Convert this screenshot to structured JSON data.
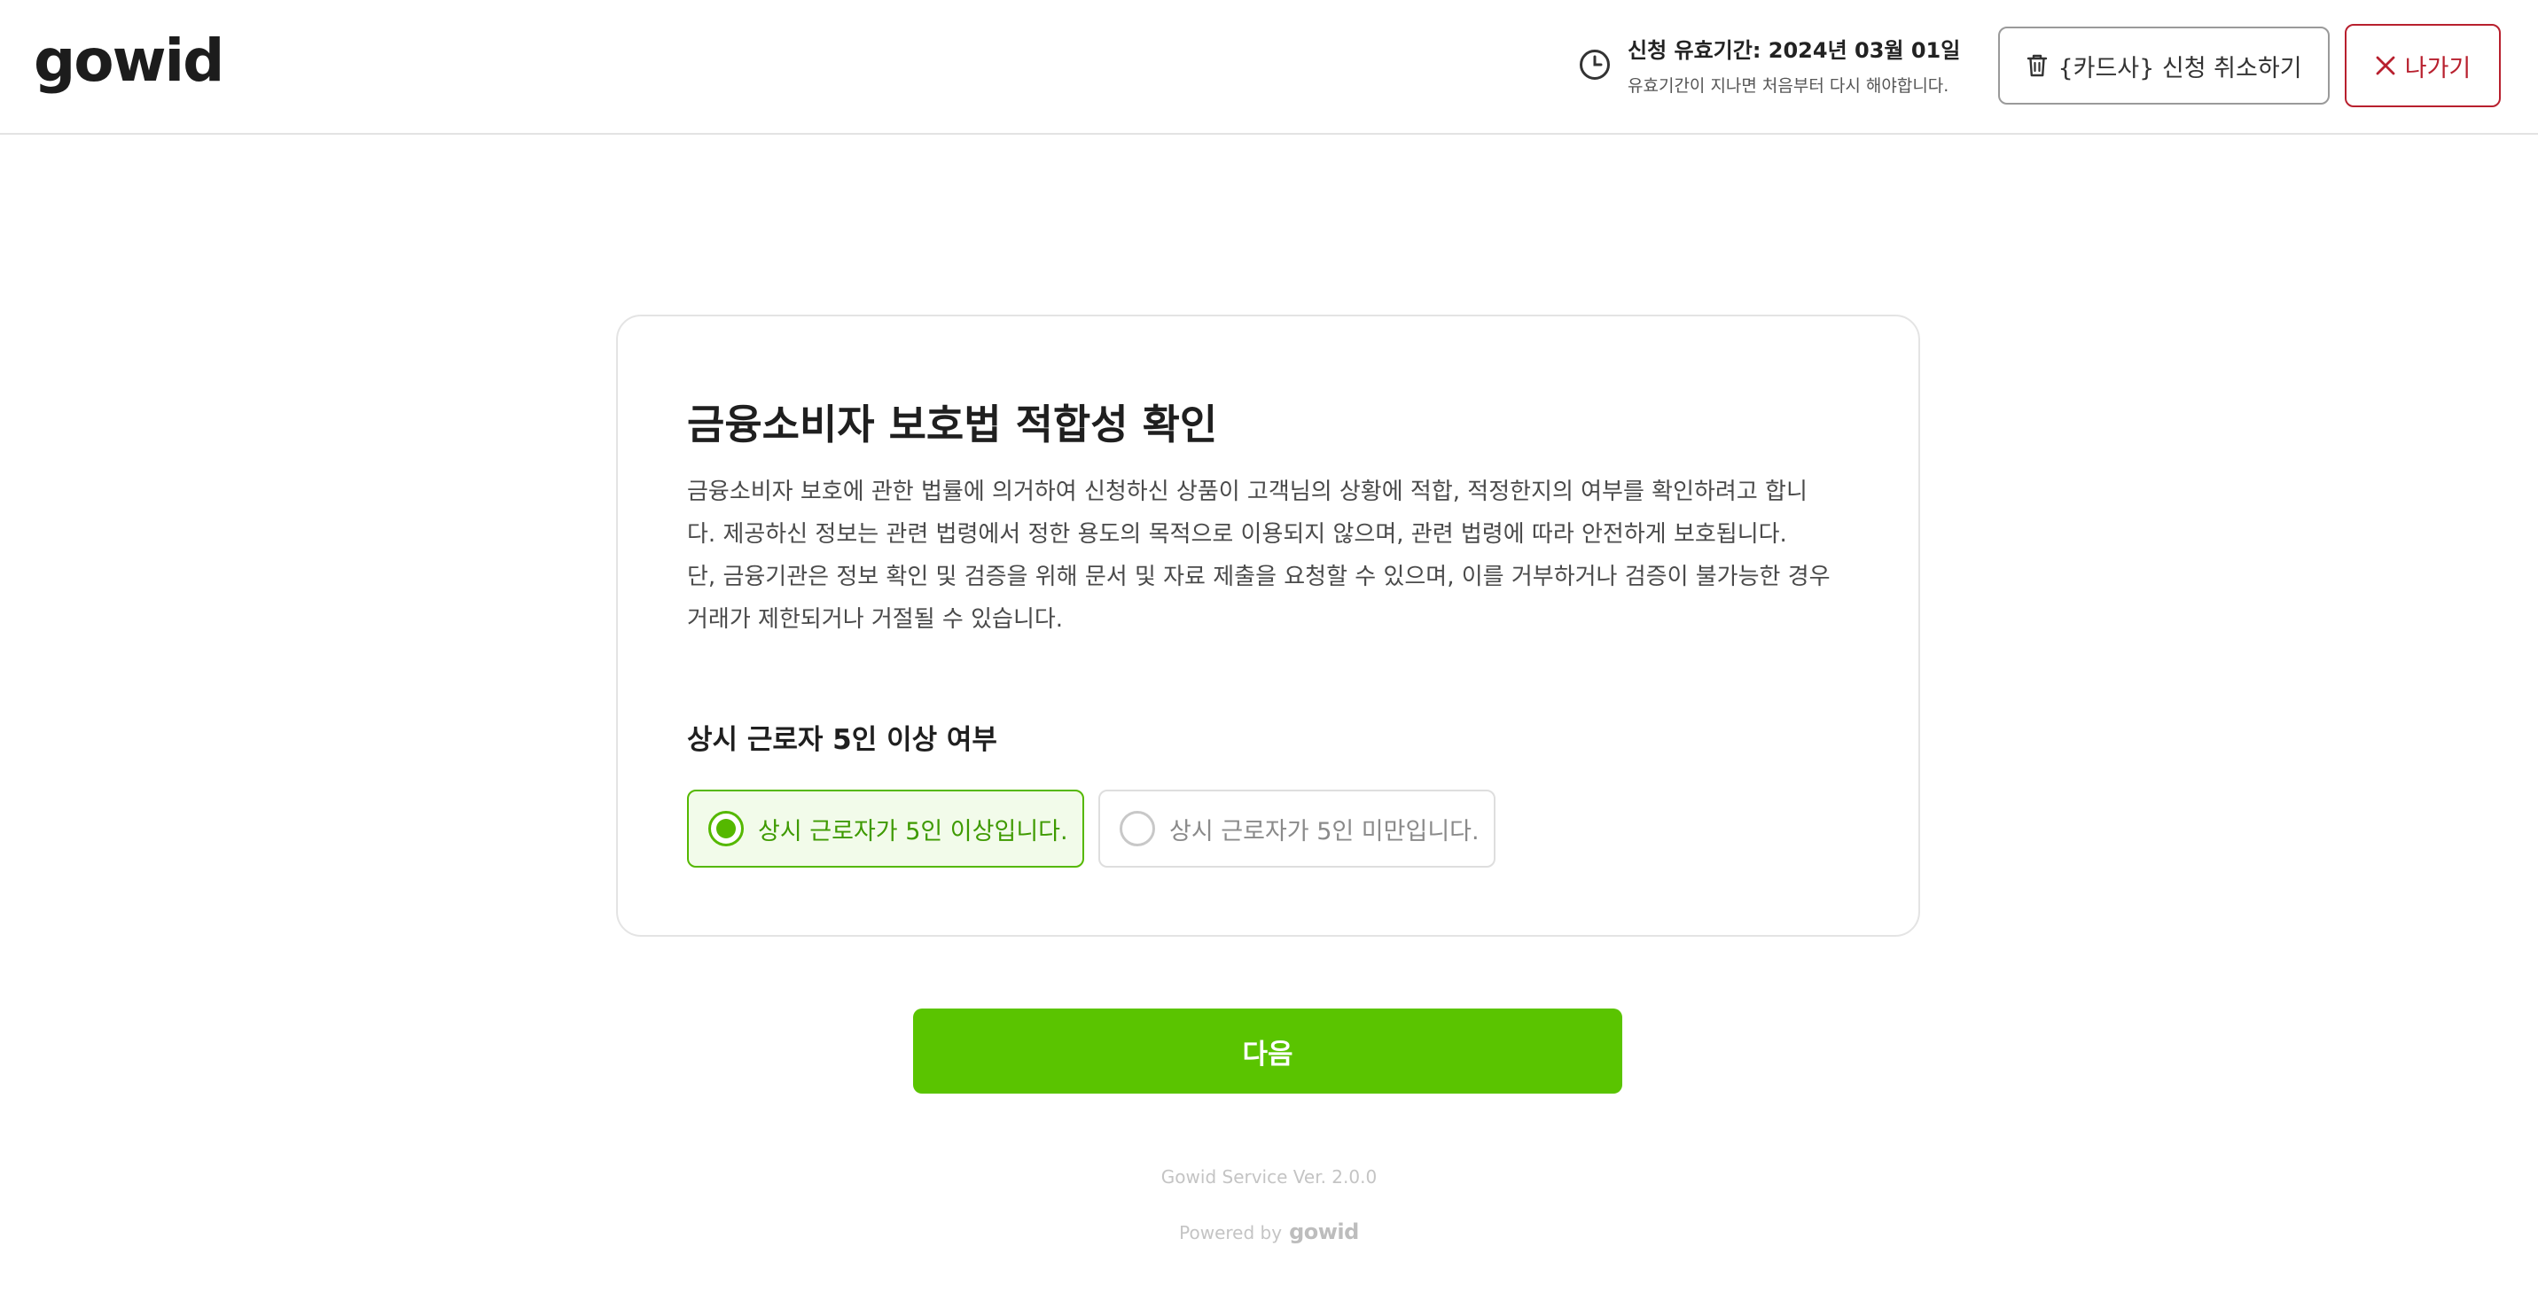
{
  "header": {
    "logo": "gowid",
    "expiry_title": "신청 유효기간: 2024년 03월 01일",
    "expiry_note": "유효기간이 지나면 처음부터 다시 해야합니다.",
    "cancel_label": "{카드사} 신청 취소하기",
    "exit_label": "나가기"
  },
  "card": {
    "title": "금융소비자 보호법 적합성 확인",
    "description_lines": [
      "금융소비자 보호에 관한 법률에 의거하여 신청하신 상품이  고객님의 상황에 적합, 적정한지의 여부를 확인하려고 합니",
      "다. 제공하신 정보는 관련 법령에서 정한 용도의 목적으로 이용되지 않으며, 관련 법령에 따라 안전하게 보호됩니다.",
      "단, 금융기관은 정보 확인 및 검증을 위해 문서 및 자료 제출을 요청할 수 있으며, 이를 거부하거나 검증이 불가능한 경우",
      "거래가 제한되거나 거절될 수 있습니다."
    ],
    "question": "상시 근로자 5인 이상 여부",
    "options": [
      {
        "label": "상시 근로자가 5인 이상입니다.",
        "selected": true
      },
      {
        "label": "상시 근로자가 5인 미만입니다.",
        "selected": false
      }
    ]
  },
  "next_label": "다음",
  "footer": {
    "version": "Gowid Service Ver. 2.0.0",
    "powered_by": "Powered by",
    "powered_logo": "gowid"
  },
  "colors": {
    "accent": "#5ac400",
    "danger": "#b8202e"
  },
  "icons": {
    "expiry": "clock-icon",
    "cancel": "trash-icon",
    "exit": "close-icon"
  }
}
